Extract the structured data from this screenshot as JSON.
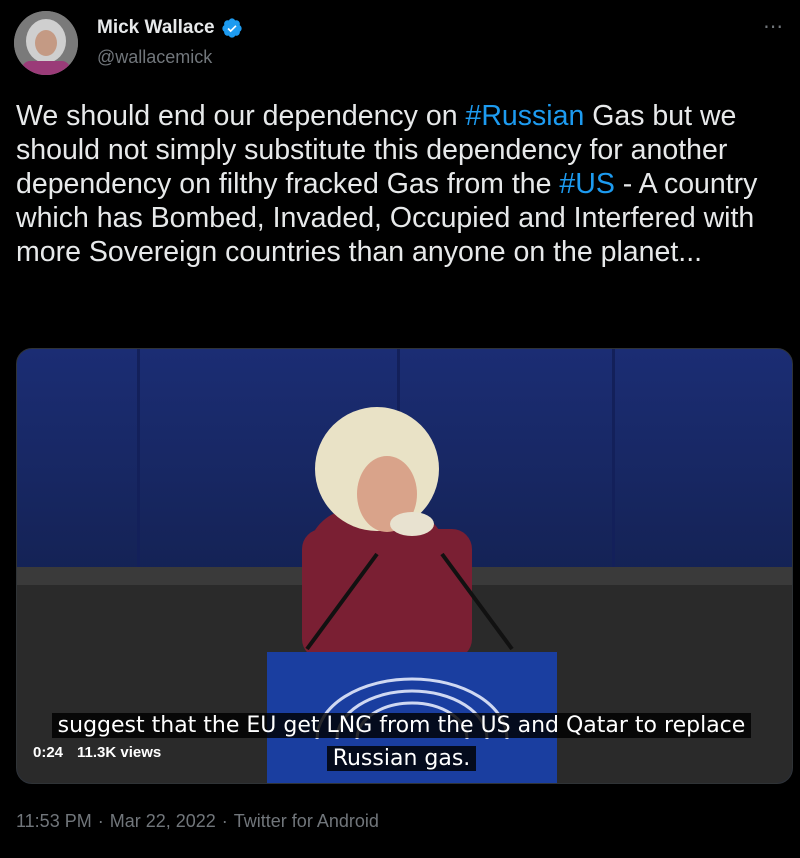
{
  "author": {
    "name": "Mick Wallace",
    "handle": "@wallacemick"
  },
  "more_icon": "⋯",
  "tweet": {
    "parts": [
      {
        "text": "We should end our dependency on ",
        "hashtag": false
      },
      {
        "text": "#Russian",
        "hashtag": true
      },
      {
        "text": " Gas but we should not simply substitute this dependency for another dependency on filthy fracked Gas from the ",
        "hashtag": false
      },
      {
        "text": "#US",
        "hashtag": true
      },
      {
        "text": " - A country which has Bombed, Invaded, Occupied and Interfered with more Sovereign countries than anyone on the planet...",
        "hashtag": false
      }
    ]
  },
  "video": {
    "caption_line1": "suggest that the EU get LNG from the US and Qatar to replace",
    "caption_line2": "Russian gas.",
    "duration": "0:24",
    "views": "11.3K views"
  },
  "meta": {
    "time": "11:53 PM",
    "date": "Mar 22, 2022",
    "separator": "·",
    "client": "Twitter for Android"
  },
  "colors": {
    "background": "#000000",
    "text": "#e7e9ea",
    "secondary": "#71767b",
    "link": "#1d9bf0",
    "verified": "#1d9bf0"
  }
}
